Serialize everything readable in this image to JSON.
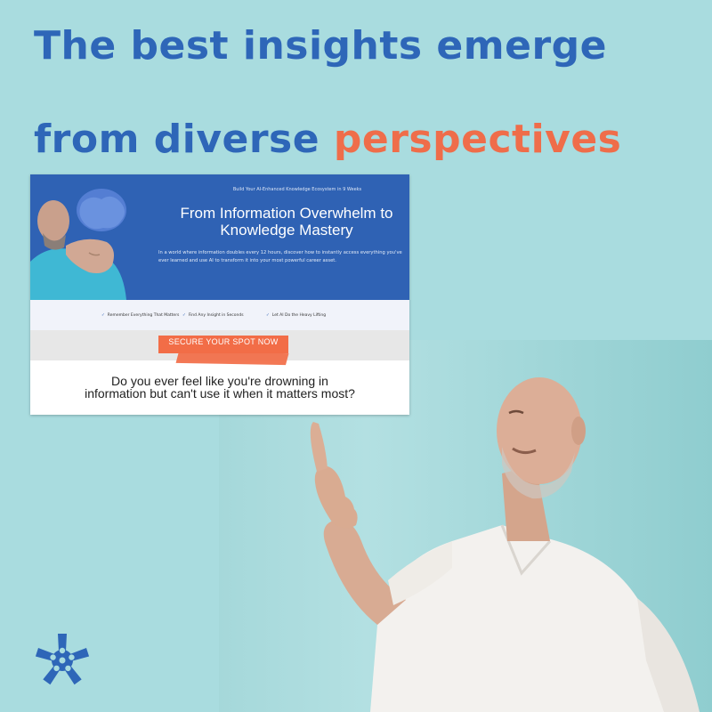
{
  "headline": {
    "line1": "The best insights emerge",
    "line2_part1": "from diverse ",
    "line2_part2": "perspectives"
  },
  "landing_page": {
    "eyebrow": "Build Your AI-Enhanced Knowledge Ecosystem in 9 Weeks",
    "title": "From Information Overwhelm to Knowledge Mastery",
    "body": "In a world where information doubles every 12 hours, discover how to instantly access everything you've ever learned and use AI to transform it into your most powerful career asset.",
    "features": [
      "Remember Everything That Matters",
      "Find Any Insight in Seconds",
      "Let AI Do the Heavy Lifting"
    ],
    "cta_label": "SECURE YOUR SPOT NOW",
    "question": "Do you ever feel like you're drowning in information but can't use it when it matters most?"
  },
  "icons": {
    "feature_check": "checkmark-icon",
    "logo": "asterisk-star-logo"
  },
  "colors": {
    "background": "#a9dcdf",
    "headline_blue": "#2e66b8",
    "headline_orange": "#ef6d4a",
    "hero_blue": "#2f62b4",
    "cta_orange": "#f26d47"
  }
}
